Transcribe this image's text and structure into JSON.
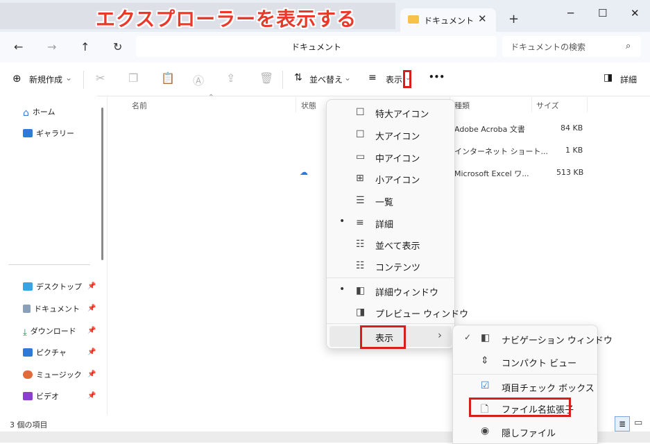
{
  "banner": {
    "text": "エクスプローラーを表示する"
  },
  "tab": {
    "label": "ドキュメント",
    "close": "✕",
    "new": "+"
  },
  "window_controls": {
    "minimize": "─",
    "maximize": "☐",
    "close": "✕"
  },
  "nav": {
    "back": "←",
    "forward": "→",
    "up": "↑",
    "refresh": "↻"
  },
  "address": {
    "path": "ドキュメント"
  },
  "search": {
    "placeholder": "ドキュメントの検索",
    "icon": "⌕"
  },
  "toolbar": {
    "new_label": "新規作成",
    "sort_label": "並べ替え",
    "view_label": "表示",
    "more_label": "•••",
    "details_label": "詳細"
  },
  "sidebar": {
    "items": [
      {
        "label": "ホーム",
        "icon": "home-icon"
      },
      {
        "label": "ギャラリー",
        "icon": "gallery-icon"
      }
    ],
    "pinned": [
      {
        "label": "デスクトップ",
        "icon": "desktop-icon"
      },
      {
        "label": "ドキュメント",
        "icon": "documents-icon"
      },
      {
        "label": "ダウンロード",
        "icon": "download-icon"
      },
      {
        "label": "ピクチャ",
        "icon": "pictures-icon"
      },
      {
        "label": "ミュージック",
        "icon": "music-icon"
      },
      {
        "label": "ビデオ",
        "icon": "video-icon"
      }
    ]
  },
  "columns": {
    "name": "名前",
    "status": "状態",
    "type": "種類",
    "size": "サイズ"
  },
  "files": [
    {
      "type": "Adobe Acroba 文書",
      "size": "84 KB"
    },
    {
      "type": "インターネット ショート...",
      "size": "1 KB"
    },
    {
      "type": "Microsoft Excel ワ...",
      "size": "513 KB"
    }
  ],
  "view_menu": {
    "items": [
      {
        "label": "特大アイコン",
        "icon": "☐"
      },
      {
        "label": "大アイコン",
        "icon": "☐"
      },
      {
        "label": "中アイコン",
        "icon": "▭"
      },
      {
        "label": "小アイコン",
        "icon": "⊞"
      },
      {
        "label": "一覧",
        "icon": "☰"
      },
      {
        "label": "詳細",
        "icon": "≡",
        "selected": true
      },
      {
        "label": "並べて表示",
        "icon": "☷"
      },
      {
        "label": "コンテンツ",
        "icon": "☷"
      },
      {
        "label": "詳細ウィンドウ",
        "icon": "◧",
        "selected": true
      },
      {
        "label": "プレビュー ウィンドウ",
        "icon": "◨"
      },
      {
        "label": "表示",
        "icon": "›"
      }
    ]
  },
  "show_submenu": {
    "items": [
      {
        "label": "ナビゲーション ウィンドウ",
        "icon": "◧",
        "checked": true
      },
      {
        "label": "コンパクト ビュー",
        "icon": "⇕"
      },
      {
        "label": "項目チェック ボックス",
        "icon": "☑"
      },
      {
        "label": "ファイル名拡張子",
        "icon": "🗋"
      },
      {
        "label": "隠しファイル",
        "icon": "◉"
      }
    ]
  },
  "status": {
    "text": "3 個の項目"
  }
}
